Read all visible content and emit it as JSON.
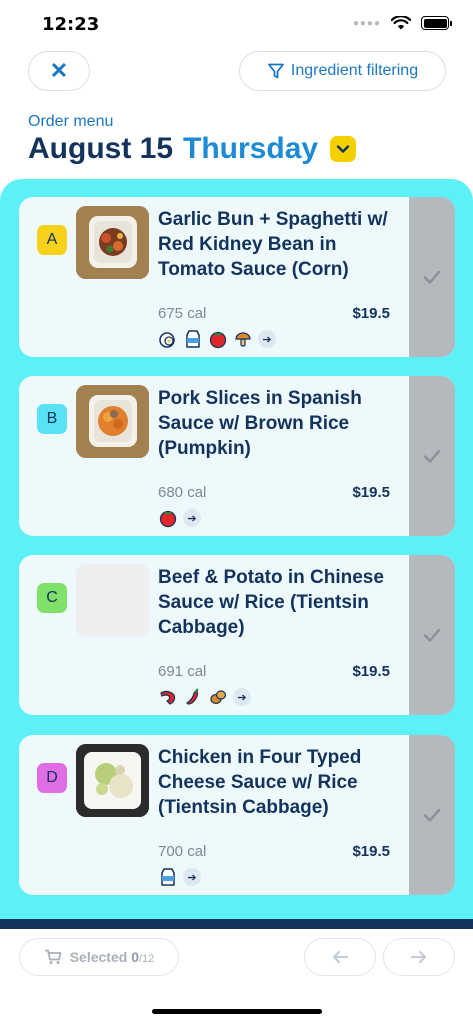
{
  "status_bar": {
    "time": "12:23"
  },
  "header": {
    "close_label": "✕",
    "filter_label": "Ingredient filtering",
    "order_label": "Order menu",
    "date": "August 15",
    "day": "Thursday"
  },
  "menu": [
    {
      "letter": "A",
      "badge_color": "#f7d21d",
      "title": "Garlic Bun + Spaghetti w/ Red Kidney Bean in Tomato Sauce (Corn)",
      "calories": "675 cal",
      "price": "$19.5",
      "icons": [
        "egg-icon",
        "milk-icon",
        "tomato-icon",
        "mushroom-icon"
      ]
    },
    {
      "letter": "B",
      "badge_color": "#57e3f3",
      "title": "Pork Slices in Spanish Sauce w/ Brown Rice (Pumpkin)",
      "calories": "680 cal",
      "price": "$19.5",
      "icons": [
        "tomato-icon"
      ]
    },
    {
      "letter": "C",
      "badge_color": "#7fe06a",
      "title": "Beef & Potato in Chinese Sauce w/ Rice (Tientsin Cabbage)",
      "calories": "691 cal",
      "price": "$19.5",
      "icons": [
        "shrimp-icon",
        "chili-icon",
        "nuts-icon"
      ]
    },
    {
      "letter": "D",
      "badge_color": "#df6ee6",
      "title": "Chicken in Four Typed Cheese Sauce w/ Rice (Tientsin Cabbage)",
      "calories": "700 cal",
      "price": "$19.5",
      "icons": [
        "milk-icon"
      ]
    }
  ],
  "footer": {
    "selected_label": "Selected",
    "selected_count": "0",
    "selected_total": "/12"
  },
  "colors": {
    "accent": "#1c77c3",
    "navy": "#13335c",
    "panel": "#5bf1f6",
    "card": "#eef9fc",
    "check_strip": "#b4b9bd",
    "dropdown": "#f5d000"
  }
}
